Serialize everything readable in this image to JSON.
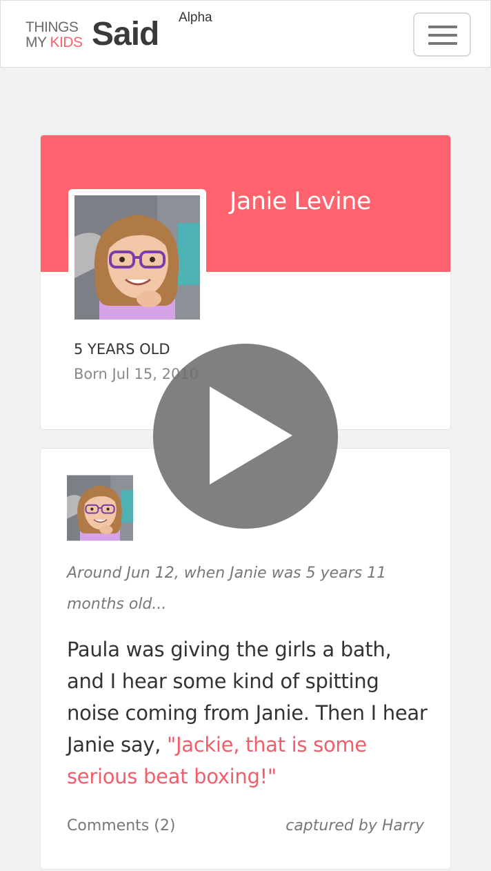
{
  "header": {
    "logo": {
      "line1": "THINGS",
      "line2_my": "MY",
      "line2_kids": "KIDS",
      "said": "Said"
    },
    "badge": "Alpha",
    "menu_icon": "hamburger-menu-icon"
  },
  "profile": {
    "name": "Janie Levine",
    "age": "5 YEARS OLD",
    "born": "Born Jul 15, 2010",
    "photo": "child-photo"
  },
  "quote": {
    "when": "Around Jun 12, when Janie was 5 years 11 months old...",
    "body": "Paula was giving the girls a bath, and I hear some kind of spitting noise coming from Janie. Then I hear Janie say, ",
    "said": "\"Jackie, that is some serious beat boxing!\"",
    "comments": "Comments (2)",
    "captured_by": "captured by Harry"
  },
  "overlay": {
    "icon": "play-icon"
  },
  "colors": {
    "brand": "#fe636e",
    "quote_accent": "#f35d6a",
    "background": "#f2f2f2"
  }
}
